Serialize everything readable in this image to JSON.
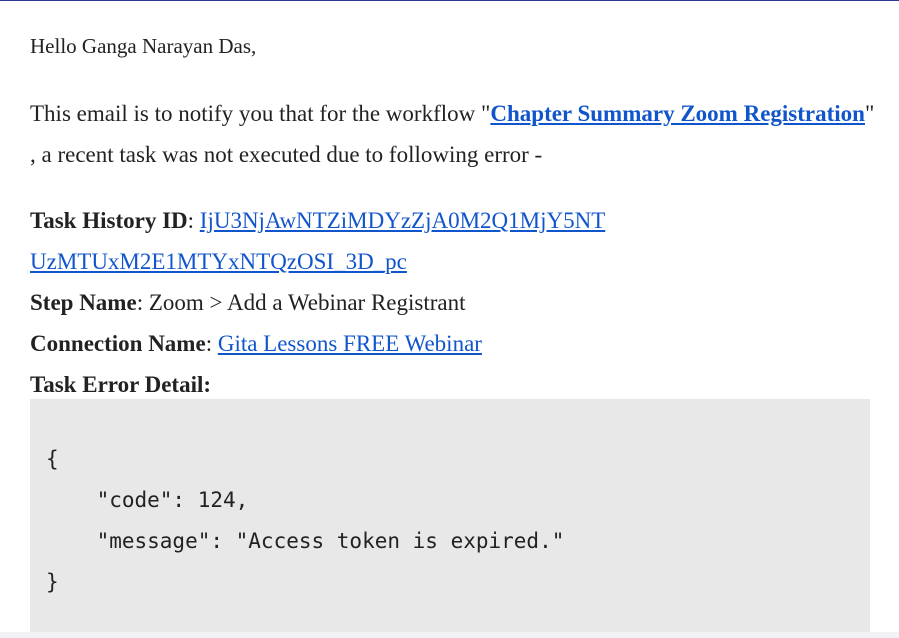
{
  "email": {
    "greeting": "Hello Ganga Narayan Das,",
    "notice_prefix": "This email is to notify you that for the workflow \"",
    "workflow_link": "Chapter Summary Zoom Registration",
    "notice_suffix": "\" , a recent task was not executed due to following error -",
    "task_history": {
      "label": "Task History ID",
      "value_line1": "IjU3NjAwNTZiMDYzZjA0M2Q1MjY5NT",
      "value_line2": "UzMTUxM2E1MTYxNTQzOSI_3D_pc"
    },
    "step": {
      "label": "Step Name",
      "value": "Zoom > Add a Webinar Registrant"
    },
    "connection": {
      "label": "Connection Name",
      "value": "Gita Lessons FREE Webinar"
    },
    "error_detail": {
      "label": "Task Error Detail:",
      "code_block": "{\n    \"code\": 124,\n    \"message\": \"Access token is expired.\"\n}"
    }
  },
  "colors": {
    "link": "#1155cc",
    "code_background": "#e8e8e8",
    "text": "#222222"
  }
}
